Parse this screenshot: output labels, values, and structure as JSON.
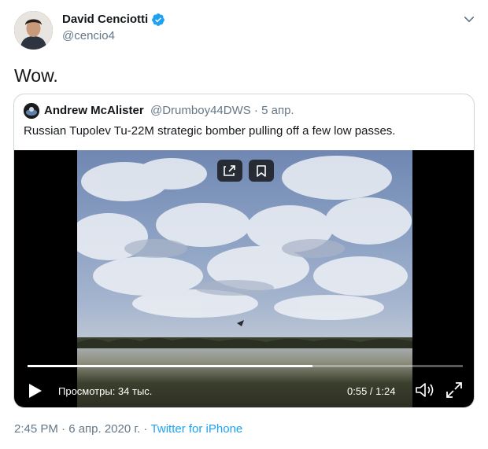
{
  "author": {
    "name": "David Cenciotti",
    "handle": "@cencio4",
    "verified": true
  },
  "tweet": {
    "text": "Wow."
  },
  "quoted_tweet": {
    "author_name": "Andrew McAlister",
    "author_handle": "@Drumboy44DWS",
    "date": "5 апр.",
    "text": "Russian Tupolev Tu-22M strategic bomber pulling off a few low passes."
  },
  "video": {
    "views": "Просмотры: 34 тыс.",
    "time": "0:55 / 1:24",
    "progress_fraction": 0.655,
    "overlay_buttons": [
      "share-icon",
      "bookmark-icon"
    ]
  },
  "footer": {
    "timestamp": "2:45 PM · 6 апр. 2020 г.",
    "separator": " · ",
    "source": "Twitter for iPhone"
  },
  "colors": {
    "accent": "#1da1f2",
    "secondary_text": "#657786",
    "border": "#ccd6dd"
  },
  "icons": [
    "verified-badge-icon",
    "chevron-down-icon",
    "play-icon",
    "volume-icon",
    "fullscreen-icon"
  ]
}
